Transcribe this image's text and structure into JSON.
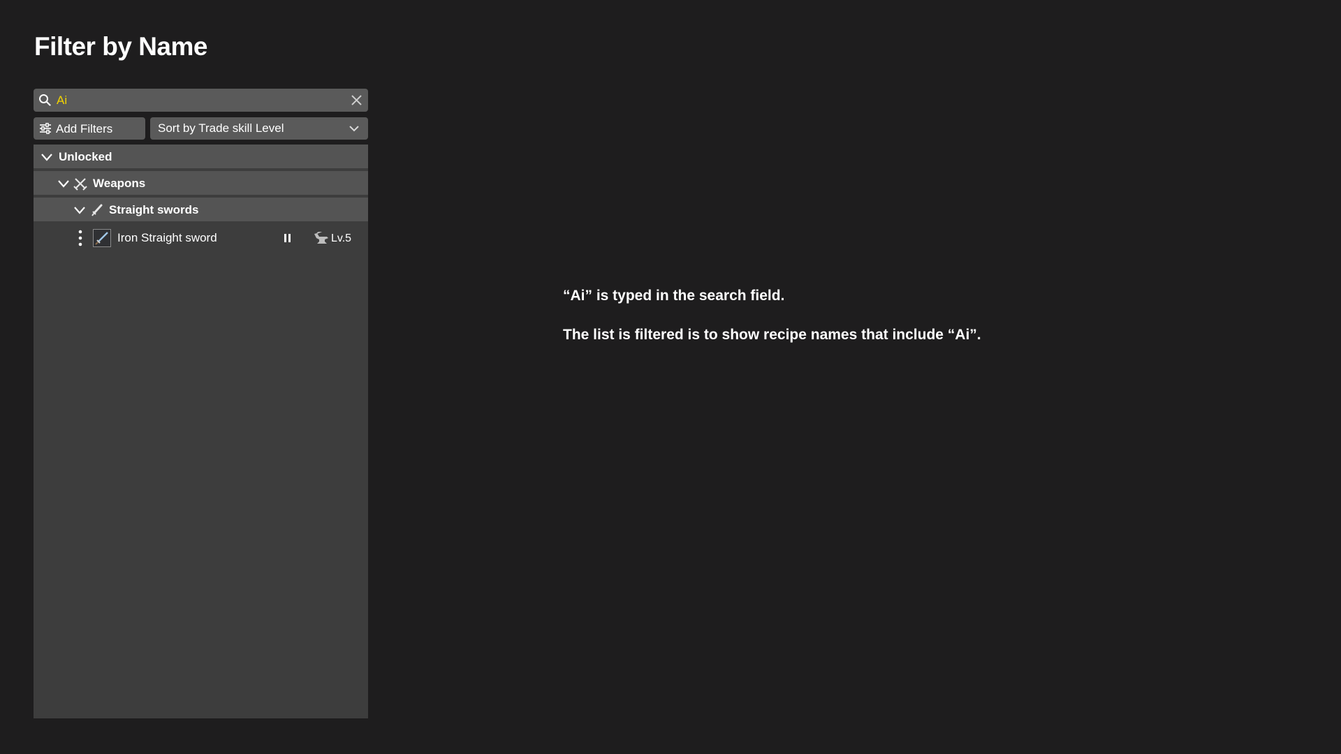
{
  "page": {
    "title": "Filter by Name"
  },
  "search": {
    "value": "Ai"
  },
  "toolbar": {
    "add_filters_label": "Add Filters",
    "sort_label": "Sort by Trade skill Level"
  },
  "tree": {
    "unlocked_label": "Unlocked",
    "weapons_label": "Weapons",
    "straight_swords_label": "Straight swords",
    "items": [
      {
        "name": "Iron Straight sword",
        "level": "Lv.5"
      }
    ]
  },
  "notes": {
    "line1": "“Ai” is typed in the search field.",
    "line2": "The list is filtered is to show recipe names that include “Ai”."
  },
  "colors": {
    "background": "#1e1d1e",
    "panel": "#3d3d3d",
    "group_row": "#545454",
    "control": "#5a5a5a",
    "search_text": "#f2d300"
  },
  "icons": {
    "search": "search-icon",
    "clear": "close-icon",
    "filters": "sliders-icon",
    "dropdown": "chevron-down-icon",
    "weapons": "crossed-swords-icon",
    "straight_swords": "sword-icon",
    "more": "kebab-menu-icon",
    "pause": "pause-icon",
    "anvil": "anvil-icon"
  }
}
